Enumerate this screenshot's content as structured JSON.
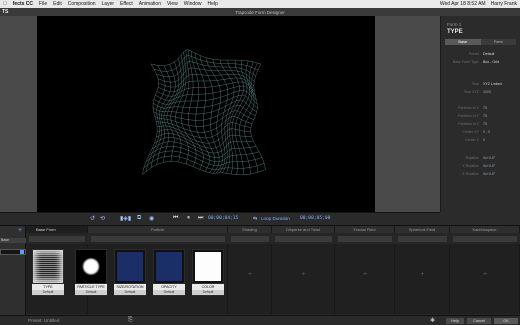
{
  "menubar": {
    "apple": "",
    "items": [
      "fects CC",
      "File",
      "Edit",
      "Composition",
      "Layer",
      "Effect",
      "Animation",
      "View",
      "Window",
      "Help"
    ],
    "right": [
      "Wed Apr 18 8:52 AM",
      "Harry Frank"
    ]
  },
  "window": {
    "title": "Trapcode Form Designer",
    "left_tag": "TS"
  },
  "inspector": {
    "header": "Form 1",
    "section": "TYPE",
    "tabs": [
      "Base",
      "Form"
    ],
    "rows": [
      {
        "label": "Preset",
        "value": "Default"
      },
      {
        "label": "Base Form Type",
        "value": "Box - Grid"
      },
      {
        "label": "Size",
        "value": "XYZ Linked"
      },
      {
        "label": "Size XYZ",
        "value": "1000"
      },
      {
        "label": "Particles in X",
        "value": "75"
      },
      {
        "label": "Particles in Y",
        "value": "75"
      },
      {
        "label": "Particles in Z",
        "value": "75"
      },
      {
        "label": "Center XY",
        "value": "0 , 0"
      },
      {
        "label": "Center Z",
        "value": "0"
      },
      {
        "label": "Rotation",
        "value": "0x+0.0°"
      },
      {
        "label": "Y Rotation",
        "value": "0x+0.0°"
      },
      {
        "label": "Z Rotation",
        "value": "0x+0.0°"
      }
    ]
  },
  "transport": {
    "current_time": "00;00;04;15",
    "loop_label": "Loop Duration",
    "loop_time": "00;00;05;00"
  },
  "flow": {
    "columns": [
      {
        "label": "Base Form"
      },
      {
        "label": "Particle"
      },
      {
        "label": "Shading"
      },
      {
        "label": "Disperse and Twist"
      },
      {
        "label": "Fractal Field"
      },
      {
        "label": "Spherical Field"
      },
      {
        "label": "Kaleidospace"
      }
    ],
    "side_select": "Base",
    "tiles": [
      {
        "name": "TYPE",
        "sub": "Default"
      },
      {
        "name": "PARTICLE TYPE",
        "sub": "Default"
      },
      {
        "name": "SIZE/ROTATION",
        "sub": "Default"
      },
      {
        "name": "OPACITY",
        "sub": "Default"
      },
      {
        "name": "COLOR",
        "sub": "Default"
      }
    ]
  },
  "status": {
    "preset_label": "Preset:",
    "preset_value": "Untitled",
    "help_label": "Help",
    "cancel_label": "Cancel",
    "ok_label": "OK"
  },
  "colors": {
    "accent": "#5aa0ff",
    "viewport_bg": "#000000",
    "wire": "#8fd8d0"
  }
}
